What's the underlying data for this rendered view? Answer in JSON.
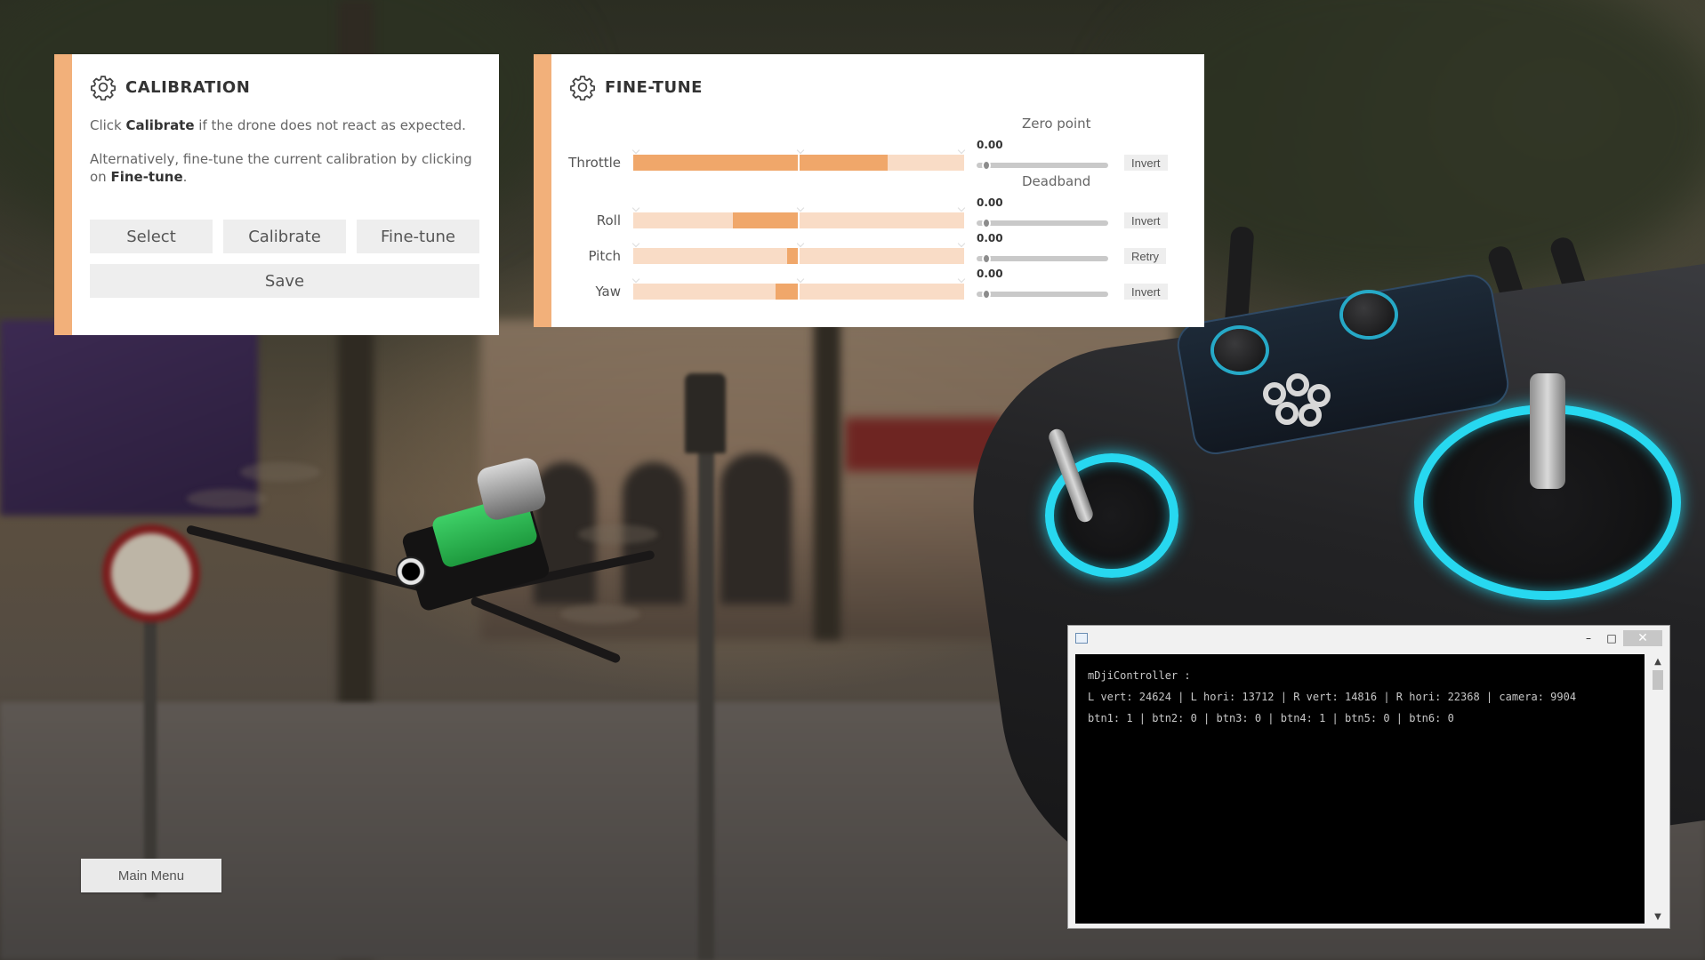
{
  "calibration": {
    "title": "CALIBRATION",
    "icon": "gear-icon",
    "line1_prefix": "Click ",
    "line1_bold": "Calibrate",
    "line1_suffix": " if the drone does not react as expected.",
    "line2_prefix": "Alternatively, fine-tune the current calibration by clicking on ",
    "line2_bold": "Fine-tune",
    "line2_suffix": ".",
    "buttons": {
      "select": "Select",
      "calibrate": "Calibrate",
      "finetune": "Fine-tune",
      "save": "Save"
    }
  },
  "finetune": {
    "title": "FINE-TUNE",
    "icon": "gear-icon",
    "zero_point_header": "Zero point",
    "deadband_header": "Deadband",
    "channels": [
      {
        "label": "Throttle",
        "fill_from": 0.0,
        "fill_to": 0.77,
        "zero_value": "0.00",
        "button": "Invert"
      },
      {
        "label": "Roll",
        "fill_from": 0.3,
        "fill_to": 0.5,
        "zero_value": "0.00",
        "button": "Invert"
      },
      {
        "label": "Pitch",
        "fill_from": 0.465,
        "fill_to": 0.5,
        "zero_value": "0.00",
        "button": "Retry"
      },
      {
        "label": "Yaw",
        "fill_from": 0.43,
        "fill_to": 0.5,
        "zero_value": "0.00",
        "button": "Invert"
      }
    ]
  },
  "main_menu": {
    "label": "Main Menu"
  },
  "console": {
    "lines": [
      "mDjiController :",
      "L vert: 24624 | L hori: 13712 | R vert: 14816 | R hori: 22368 | camera: 9904",
      "btn1: 1 | btn2: 0 | btn3: 0 | btn4: 1 | btn5: 0 | btn6: 0"
    ],
    "controls": {
      "minimize": "–",
      "maximize": "□",
      "close": "✕"
    },
    "scroll_up": "▲",
    "scroll_down": "▼"
  },
  "colors": {
    "accent": "#f2b07a",
    "fill": "#f0a76a",
    "track": "#f9dcc6",
    "ring": "#27d8f0"
  }
}
